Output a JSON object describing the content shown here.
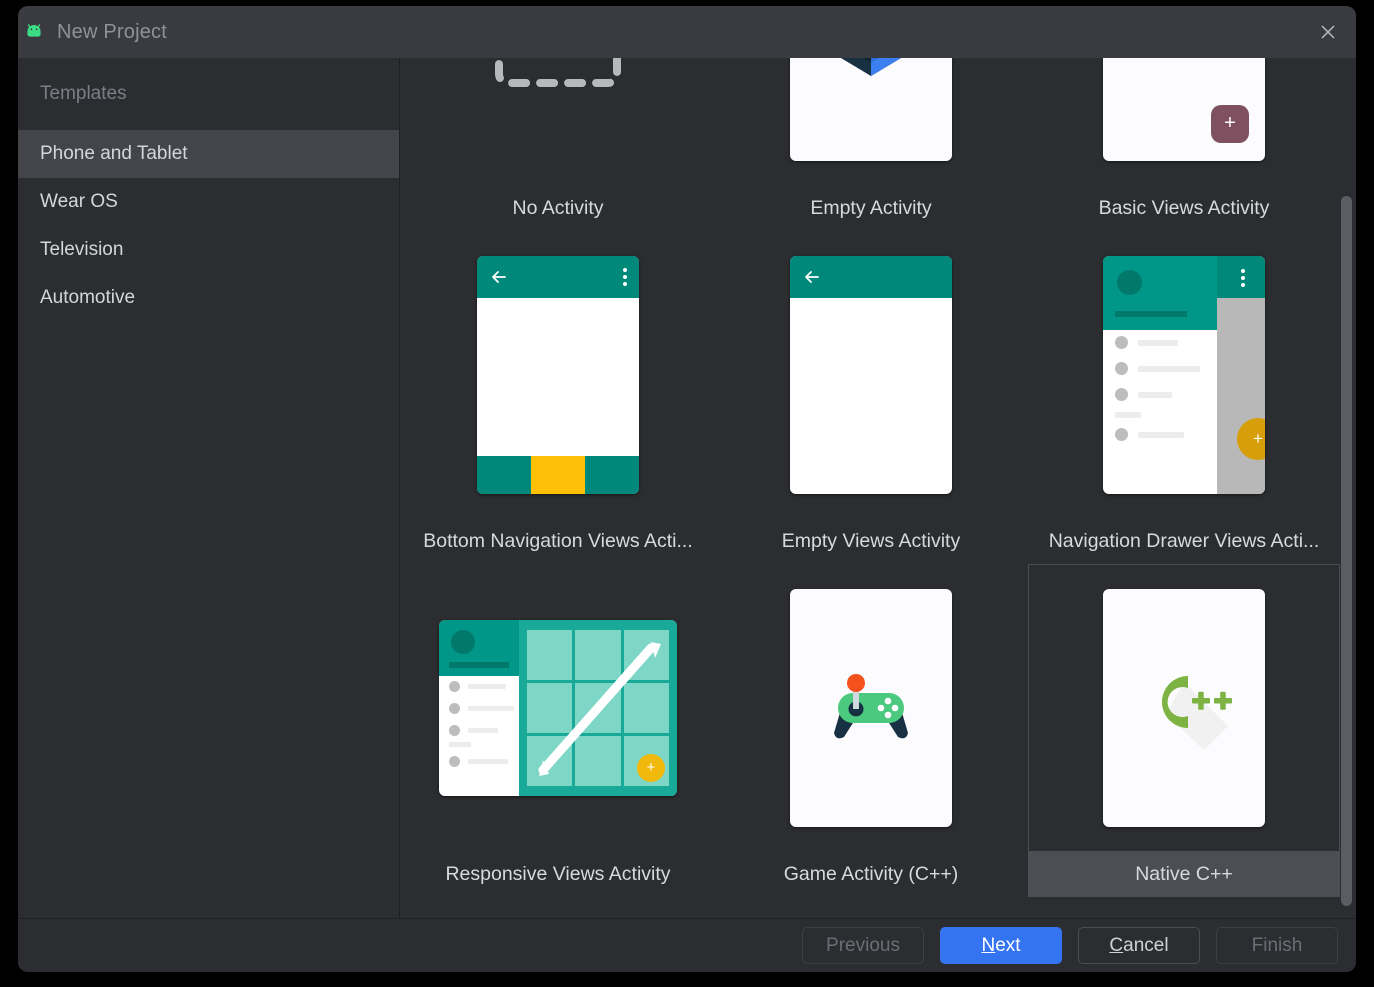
{
  "window": {
    "title": "New Project",
    "app_icon": "android-robot-icon",
    "close_icon": "close-icon"
  },
  "sidebar": {
    "header": "Templates",
    "items": [
      {
        "label": "Phone and Tablet",
        "selected": true
      },
      {
        "label": "Wear OS",
        "selected": false
      },
      {
        "label": "Television",
        "selected": false
      },
      {
        "label": "Automotive",
        "selected": false
      }
    ]
  },
  "templates": {
    "selected": "Native C++",
    "items": [
      {
        "label": "No Activity",
        "icon": "dashed-rectangle-icon"
      },
      {
        "label": "Empty Activity",
        "icon": "jetpack-compose-logo-icon"
      },
      {
        "label": "Basic Views Activity",
        "icon": "phone-with-fab-icon"
      },
      {
        "label": "Bottom Navigation Views Acti...",
        "icon": "phone-bottom-navigation-icon"
      },
      {
        "label": "Empty Views Activity",
        "icon": "phone-empty-appbar-icon"
      },
      {
        "label": "Navigation Drawer Views Acti...",
        "icon": "phone-navigation-drawer-icon"
      },
      {
        "label": "Responsive Views Activity",
        "icon": "tablet-responsive-grid-icon"
      },
      {
        "label": "Game Activity (C++)",
        "icon": "gamepad-icon"
      },
      {
        "label": "Native C++",
        "icon": "cplusplus-logo-icon"
      }
    ]
  },
  "footer": {
    "previous": {
      "label": "Previous",
      "enabled": false
    },
    "next": {
      "label": "Next",
      "mnemonic": "N",
      "enabled": true,
      "primary": true
    },
    "cancel": {
      "label": "Cancel",
      "mnemonic": "C",
      "enabled": true
    },
    "finish": {
      "label": "Finish",
      "enabled": false
    }
  },
  "colors": {
    "window_bg": "#2b2d30",
    "titlebar_bg": "#393b40",
    "selection_bg": "#43454a",
    "accent_blue": "#3574f0",
    "teal": "#00897b",
    "amber": "#ffc107",
    "mauve": "#7e5060",
    "cpp_green": "#7cb342",
    "android_green": "#3ddc84"
  }
}
